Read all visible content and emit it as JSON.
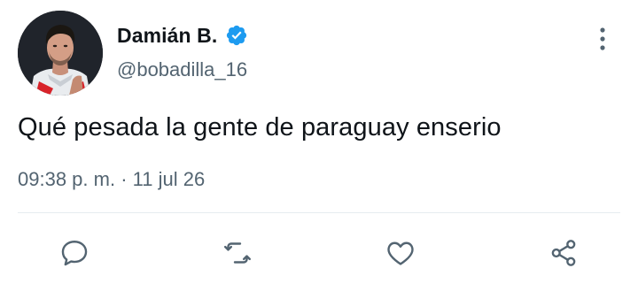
{
  "tweet": {
    "author": {
      "display_name": "Damián B.",
      "handle": "@bobadilla_16",
      "verified": true,
      "avatar_icon": "user-avatar-photo",
      "verified_icon": "verified-badge-icon",
      "verified_color": "#1d9bf0"
    },
    "text": "Qué pesada la gente de paraguay enserio",
    "meta": {
      "time": "09:38 p. m.",
      "separator": "·",
      "date": "11 jul 26"
    },
    "more_icon": "more-vertical-icon",
    "actions": [
      {
        "name": "reply",
        "icon": "reply-icon"
      },
      {
        "name": "retweet",
        "icon": "retweet-icon"
      },
      {
        "name": "like",
        "icon": "heart-icon"
      },
      {
        "name": "share",
        "icon": "share-icon"
      }
    ],
    "colors": {
      "text_primary": "#0f1419",
      "text_secondary": "#536471",
      "icon": "#536471",
      "divider": "#e6ecf0"
    }
  }
}
